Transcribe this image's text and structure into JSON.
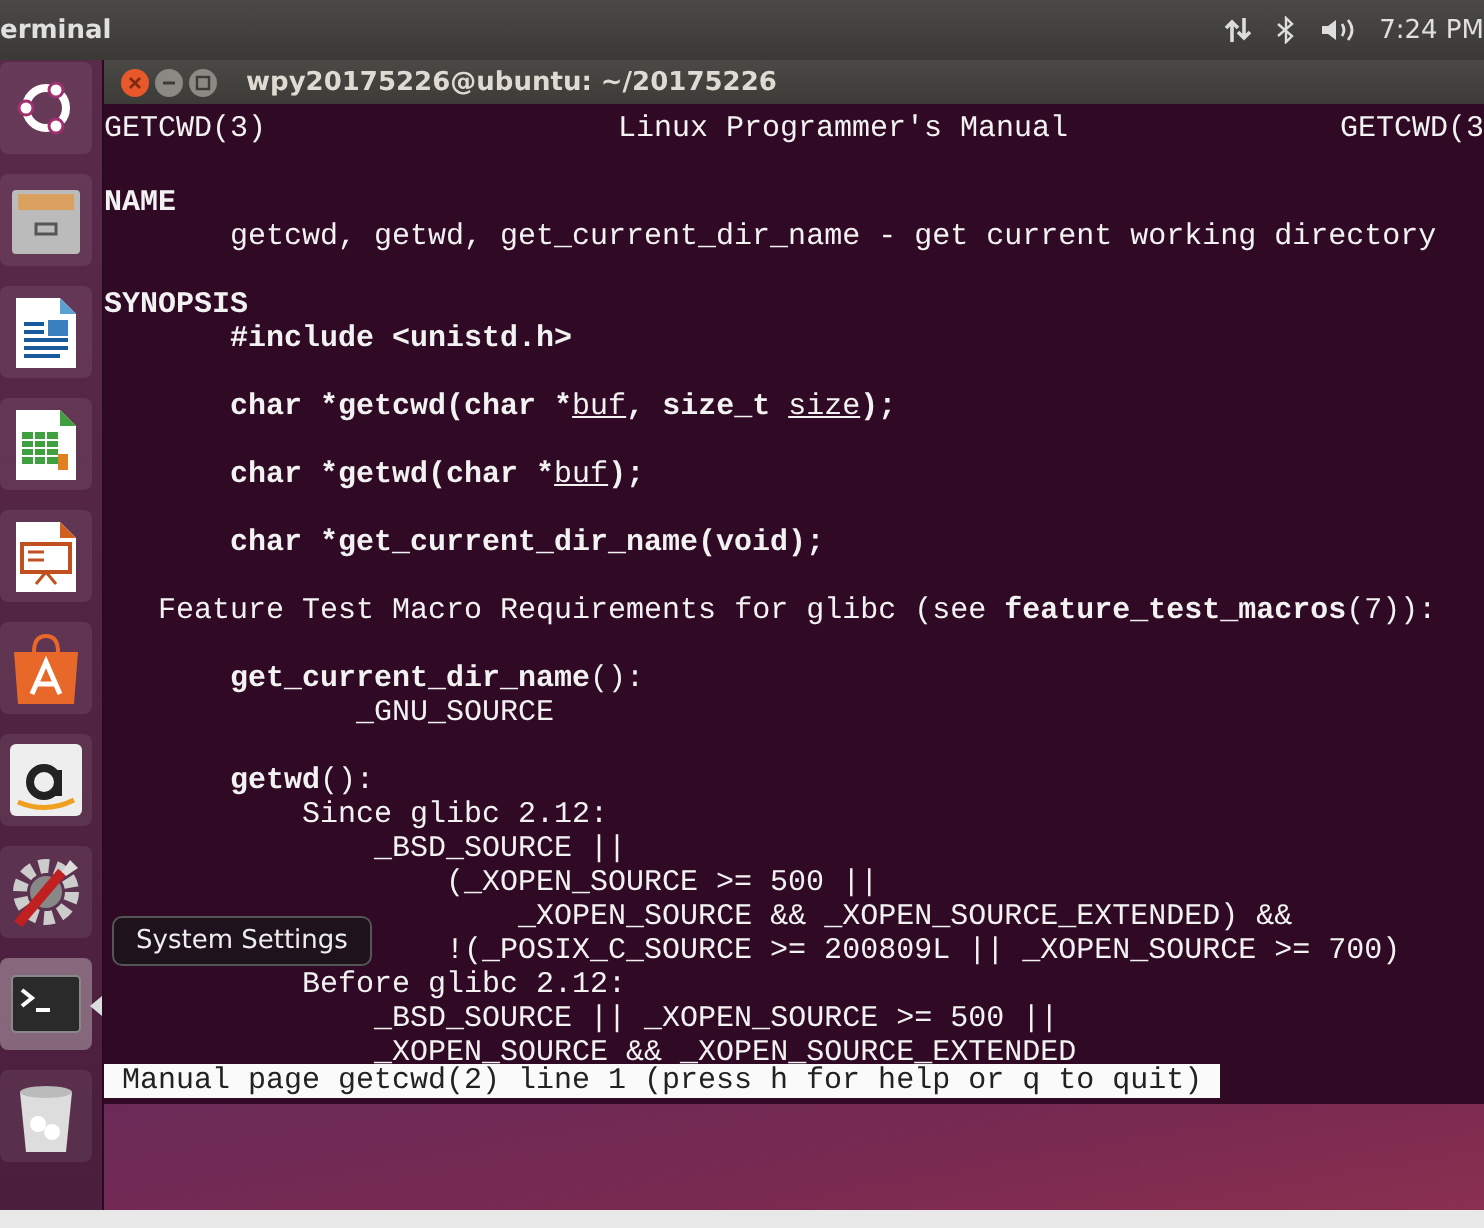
{
  "top_panel": {
    "app_name": "erminal",
    "clock": "7:24 PM"
  },
  "launcher": {
    "items": [
      {
        "kind": "ubuntu",
        "active": false
      },
      {
        "kind": "files",
        "active": false
      },
      {
        "kind": "writer",
        "active": false
      },
      {
        "kind": "calc",
        "active": false
      },
      {
        "kind": "impress",
        "active": false
      },
      {
        "kind": "software",
        "active": false
      },
      {
        "kind": "amazon",
        "active": false
      },
      {
        "kind": "settings",
        "active": false
      },
      {
        "kind": "terminal",
        "active": true
      },
      {
        "kind": "trash",
        "active": false
      }
    ],
    "tooltip": "System Settings"
  },
  "window": {
    "title": "wpy20175226@ubuntu: ~/20175226"
  },
  "man_page": {
    "header": {
      "left": "GETCWD(3)",
      "center": "Linux Programmer's Manual",
      "right": "GETCWD(3"
    },
    "lines": [
      {
        "kind": "blank"
      },
      {
        "kind": "text",
        "segments": [
          {
            "text": "NAME",
            "kind": "bold"
          }
        ]
      },
      {
        "kind": "text",
        "segments": [
          {
            "text": "       getcwd, getwd, get_current_dir_name - get current working directory",
            "kind": "plain"
          }
        ]
      },
      {
        "kind": "blank"
      },
      {
        "kind": "text",
        "segments": [
          {
            "text": "SYNOPSIS",
            "kind": "bold"
          }
        ]
      },
      {
        "kind": "text",
        "segments": [
          {
            "text": "       #include <unistd.h>",
            "kind": "bold"
          }
        ]
      },
      {
        "kind": "blank"
      },
      {
        "kind": "text",
        "segments": [
          {
            "text": "       char *getcwd(char *",
            "kind": "bold"
          },
          {
            "text": "buf",
            "kind": "underline"
          },
          {
            "text": ", size_t ",
            "kind": "bold"
          },
          {
            "text": "size",
            "kind": "underline"
          },
          {
            "text": ");",
            "kind": "bold"
          }
        ]
      },
      {
        "kind": "blank"
      },
      {
        "kind": "text",
        "segments": [
          {
            "text": "       char *getwd(char *",
            "kind": "bold"
          },
          {
            "text": "buf",
            "kind": "underline"
          },
          {
            "text": ");",
            "kind": "bold"
          }
        ]
      },
      {
        "kind": "blank"
      },
      {
        "kind": "text",
        "segments": [
          {
            "text": "       char *get_current_dir_name(void);",
            "kind": "bold"
          }
        ]
      },
      {
        "kind": "blank"
      },
      {
        "kind": "text",
        "segments": [
          {
            "text": "   Feature Test Macro Requirements for glibc (see ",
            "kind": "plain"
          },
          {
            "text": "feature_test_macros",
            "kind": "bold"
          },
          {
            "text": "(7)):",
            "kind": "plain"
          }
        ]
      },
      {
        "kind": "blank"
      },
      {
        "kind": "text",
        "segments": [
          {
            "text": "       get_current_dir_name",
            "kind": "bold"
          },
          {
            "text": "():",
            "kind": "plain"
          }
        ]
      },
      {
        "kind": "text",
        "segments": [
          {
            "text": "              _GNU_SOURCE",
            "kind": "plain"
          }
        ]
      },
      {
        "kind": "blank"
      },
      {
        "kind": "text",
        "segments": [
          {
            "text": "       getwd",
            "kind": "bold"
          },
          {
            "text": "():",
            "kind": "plain"
          }
        ]
      },
      {
        "kind": "text",
        "segments": [
          {
            "text": "           Since glibc 2.12:",
            "kind": "plain"
          }
        ]
      },
      {
        "kind": "text",
        "segments": [
          {
            "text": "               _BSD_SOURCE ||",
            "kind": "plain"
          }
        ]
      },
      {
        "kind": "text",
        "segments": [
          {
            "text": "                   (_XOPEN_SOURCE >= 500 ||",
            "kind": "plain"
          }
        ]
      },
      {
        "kind": "text",
        "segments": [
          {
            "text": "                       _XOPEN_SOURCE && _XOPEN_SOURCE_EXTENDED) &&",
            "kind": "plain"
          }
        ]
      },
      {
        "kind": "text",
        "segments": [
          {
            "text": "                   !(_POSIX_C_SOURCE >= 200809L || _XOPEN_SOURCE >= 700)",
            "kind": "plain"
          }
        ]
      },
      {
        "kind": "text",
        "segments": [
          {
            "text": "           Before glibc 2.12:",
            "kind": "plain"
          }
        ]
      },
      {
        "kind": "text",
        "segments": [
          {
            "text": "               _BSD_SOURCE || _XOPEN_SOURCE >= 500 ||",
            "kind": "plain"
          }
        ]
      },
      {
        "kind": "text",
        "segments": [
          {
            "text": "               _XOPEN_SOURCE && _XOPEN_SOURCE_EXTENDED",
            "kind": "plain"
          }
        ]
      }
    ],
    "status": "Manual page getcwd(2) line 1 (press h for help or q to quit)"
  }
}
